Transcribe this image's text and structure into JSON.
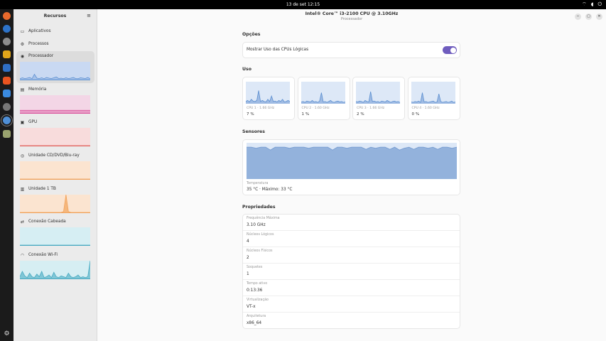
{
  "topbar": {
    "clock": "13 de set  12:15",
    "icons": [
      "network-icon",
      "volume-icon",
      "power-icon"
    ]
  },
  "dock": {
    "apps": [
      {
        "name": "firefox-icon",
        "color": "#e8692c"
      },
      {
        "name": "thunderbird-icon",
        "color": "#2d73c9"
      },
      {
        "name": "files-icon",
        "color": "#8d8d8d"
      },
      {
        "name": "rhythmbox-icon",
        "color": "#e0a51a"
      },
      {
        "name": "writer-icon",
        "color": "#2f6fc4"
      },
      {
        "name": "software-icon",
        "color": "#e95420"
      },
      {
        "name": "help-icon",
        "color": "#3a8ae0"
      },
      {
        "name": "settings-icon",
        "color": "#777777"
      },
      {
        "name": "resources-icon",
        "color": "#4f8fd6"
      },
      {
        "name": "trash-icon",
        "color": "#9aa36f"
      }
    ],
    "show_apps_icon": "grid-icon"
  },
  "sidebar": {
    "title": "Recursos",
    "menu_icon": "≡",
    "nav": [
      {
        "label": "Aplicativos",
        "icon": "▭"
      },
      {
        "label": "Processos",
        "icon": "⚙"
      }
    ],
    "resources": [
      {
        "label": "Processador",
        "icon": "◉",
        "bg": "#c9d9f2",
        "line": "#5b8fd1",
        "fill": "#a6c1e8",
        "values": [
          0.05,
          0.1,
          0.06,
          0.08,
          0.12,
          0.05,
          0.3,
          0.08,
          0.06,
          0.1,
          0.05,
          0.12,
          0.08,
          0.06,
          0.1,
          0.15,
          0.06,
          0.08,
          0.05,
          0.1,
          0.06,
          0.08,
          0.12,
          0.06,
          0.05,
          0.1,
          0.08,
          0.06,
          0.12,
          0.05
        ]
      },
      {
        "label": "Memória",
        "icon": "▤",
        "bg": "#f3d6e6",
        "line": "#d94f9a",
        "fill": "#e79ac4",
        "values": [
          0.15,
          0.15,
          0.15,
          0.15,
          0.15,
          0.15,
          0.15,
          0.15,
          0.15,
          0.15,
          0.15,
          0.15,
          0.15,
          0.15,
          0.15,
          0.15,
          0.15,
          0.15,
          0.15,
          0.15,
          0.15,
          0.15,
          0.15,
          0.15,
          0.15,
          0.15,
          0.15,
          0.15,
          0.15,
          0.15
        ]
      },
      {
        "label": "GPU",
        "icon": "▣",
        "bg": "#f8dcdc",
        "line": "#e0605b",
        "fill": "#f2b3b0",
        "values": [
          0,
          0,
          0,
          0,
          0,
          0,
          0,
          0,
          0,
          0,
          0,
          0,
          0,
          0,
          0,
          0,
          0,
          0,
          0,
          0,
          0,
          0,
          0,
          0,
          0,
          0,
          0,
          0,
          0,
          0
        ]
      },
      {
        "label": "Unidade CD/DVD/Blu-ray",
        "icon": "◎",
        "bg": "#fbe4d0",
        "line": "#f1a25a",
        "fill": "#f6c8a0",
        "values": [
          0,
          0,
          0,
          0,
          0,
          0,
          0,
          0,
          0,
          0,
          0,
          0,
          0,
          0,
          0,
          0,
          0,
          0,
          0,
          0,
          0,
          0,
          0,
          0,
          0,
          0,
          0,
          0,
          0,
          0
        ]
      },
      {
        "label": "Unidade 1 TB",
        "icon": "▥",
        "bg": "#fbe4d0",
        "line": "#f1a25a",
        "fill": "#f5b77d",
        "values": [
          0,
          0,
          0,
          0,
          0,
          0,
          0,
          0,
          0,
          0,
          0,
          0,
          0,
          0,
          0,
          0,
          0,
          0,
          0.05,
          1.0,
          0.05,
          0,
          0,
          0,
          0,
          0,
          0,
          0,
          0,
          0
        ]
      },
      {
        "label": "Conexão Cabeada",
        "icon": "⇄",
        "bg": "#d6eef3",
        "line": "#48a9c1",
        "fill": "#a8d8e4",
        "values": [
          0,
          0,
          0,
          0,
          0,
          0,
          0,
          0,
          0,
          0,
          0,
          0,
          0,
          0,
          0,
          0,
          0,
          0,
          0,
          0,
          0,
          0,
          0,
          0,
          0,
          0,
          0,
          0,
          0,
          0
        ]
      },
      {
        "label": "Conexão Wi-Fi",
        "icon": "◠",
        "bg": "#d6eef3",
        "line": "#48a9c1",
        "fill": "#7fc6d6",
        "values": [
          0.1,
          0.4,
          0.15,
          0.05,
          0.3,
          0.1,
          0.05,
          0.25,
          0.1,
          0.4,
          0.05,
          0.1,
          0.2,
          0.05,
          0.35,
          0.1,
          0.05,
          0.15,
          0.1,
          0.05,
          0.3,
          0.1,
          0.05,
          0.1,
          0.2,
          0.05,
          0.1,
          0.05,
          0.1,
          1.0
        ]
      }
    ]
  },
  "header": {
    "title": "Intel® Core™ i3-2100 CPU @ 3.10GHz",
    "subtitle": "Processador",
    "buttons": [
      "−",
      "▢",
      "✕"
    ]
  },
  "options": {
    "title": "Opções",
    "logical_cpus_label": "Mostrar Uso das CPUs Lógicas",
    "logical_cpus_on": true
  },
  "usage": {
    "title": "Uso",
    "cpus": [
      {
        "label": "CPU 1 · 1.66 GHz",
        "value": "7 %",
        "values": [
          0.1,
          0.15,
          0.08,
          0.2,
          0.12,
          0.1,
          0.15,
          0.6,
          0.1,
          0.15,
          0.1,
          0.08,
          0.2,
          0.1,
          0.35,
          0.1,
          0.12,
          0.08,
          0.15,
          0.1,
          0.2,
          0.08,
          0.1,
          0.15,
          0.1
        ]
      },
      {
        "label": "CPU 2 · 1.60 GHz",
        "value": "1 %",
        "values": [
          0.08,
          0.1,
          0.06,
          0.12,
          0.1,
          0.08,
          0.15,
          0.08,
          0.1,
          0.06,
          0.12,
          0.5,
          0.08,
          0.1,
          0.06,
          0.1,
          0.15,
          0.08,
          0.06,
          0.1,
          0.12,
          0.08,
          0.1,
          0.06,
          0.08
        ]
      },
      {
        "label": "CPU 3 · 1.66 GHz",
        "value": "2 %",
        "values": [
          0.1,
          0.08,
          0.12,
          0.1,
          0.06,
          0.15,
          0.1,
          0.08,
          0.55,
          0.1,
          0.12,
          0.08,
          0.1,
          0.06,
          0.12,
          0.1,
          0.08,
          0.15,
          0.1,
          0.06,
          0.1,
          0.12,
          0.08,
          0.1,
          0.06
        ]
      },
      {
        "label": "CPU 4 · 1.60 GHz",
        "value": "0 %",
        "values": [
          0.08,
          0.06,
          0.1,
          0.08,
          0.12,
          0.06,
          0.5,
          0.08,
          0.1,
          0.06,
          0.08,
          0.1,
          0.12,
          0.06,
          0.08,
          0.45,
          0.1,
          0.06,
          0.08,
          0.1,
          0.06,
          0.08,
          0.12,
          0.06,
          0.08
        ]
      }
    ]
  },
  "sensors": {
    "title": "Sensores",
    "label": "Temperatura",
    "value": "35 °C · Máximo: 33 °C",
    "values": [
      0.88,
      0.88,
      0.85,
      0.88,
      0.88,
      0.8,
      0.88,
      0.88,
      0.88,
      0.85,
      0.88,
      0.88,
      0.88,
      0.85,
      0.88,
      0.88,
      0.88,
      0.88,
      0.8,
      0.88,
      0.88,
      0.85,
      0.88,
      0.88,
      0.88,
      0.82,
      0.88,
      0.85,
      0.88,
      0.88,
      0.82,
      0.88,
      0.8,
      0.85,
      0.88,
      0.82,
      0.88,
      0.88,
      0.85,
      0.88,
      0.82,
      0.88,
      0.88,
      0.85,
      0.88
    ]
  },
  "properties": {
    "title": "Propriedades",
    "rows": [
      {
        "label": "Frequência Máxima",
        "value": "3.10 GHz"
      },
      {
        "label": "Núcleos Lógicos",
        "value": "4"
      },
      {
        "label": "Núcleos Físicos",
        "value": "2"
      },
      {
        "label": "Soquetes",
        "value": "1"
      },
      {
        "label": "Tempo ativo",
        "value": "0:13:36"
      },
      {
        "label": "Virtualização",
        "value": "VT-x"
      },
      {
        "label": "Arquitetura",
        "value": "x86_64"
      }
    ]
  }
}
